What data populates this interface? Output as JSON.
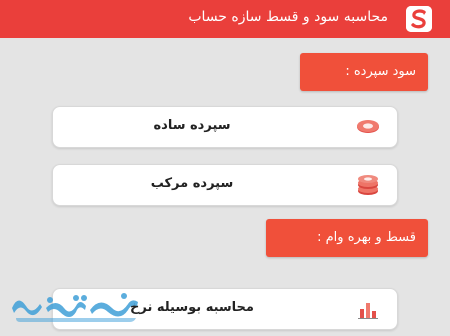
{
  "app": {
    "title": "محاسبه سود و قسط سازه حساب",
    "accent_color": "#ea3f3b",
    "logo_icon": "sazeh-hesab-logo-icon"
  },
  "sections": {
    "deposit": {
      "header": "سود سپرده :",
      "items": [
        {
          "label": "سپرده ساده",
          "icon": "coin-icon"
        },
        {
          "label": "سپرده مرکب",
          "icon": "coin-stack-icon"
        }
      ]
    },
    "loan": {
      "header": "قسط و بهره وام :",
      "items": [
        {
          "label": "محاسبه بوسیله نرخ",
          "icon": "bar-chart-icon"
        }
      ]
    }
  },
  "watermark": {
    "icon": "watermark-logo-icon"
  }
}
